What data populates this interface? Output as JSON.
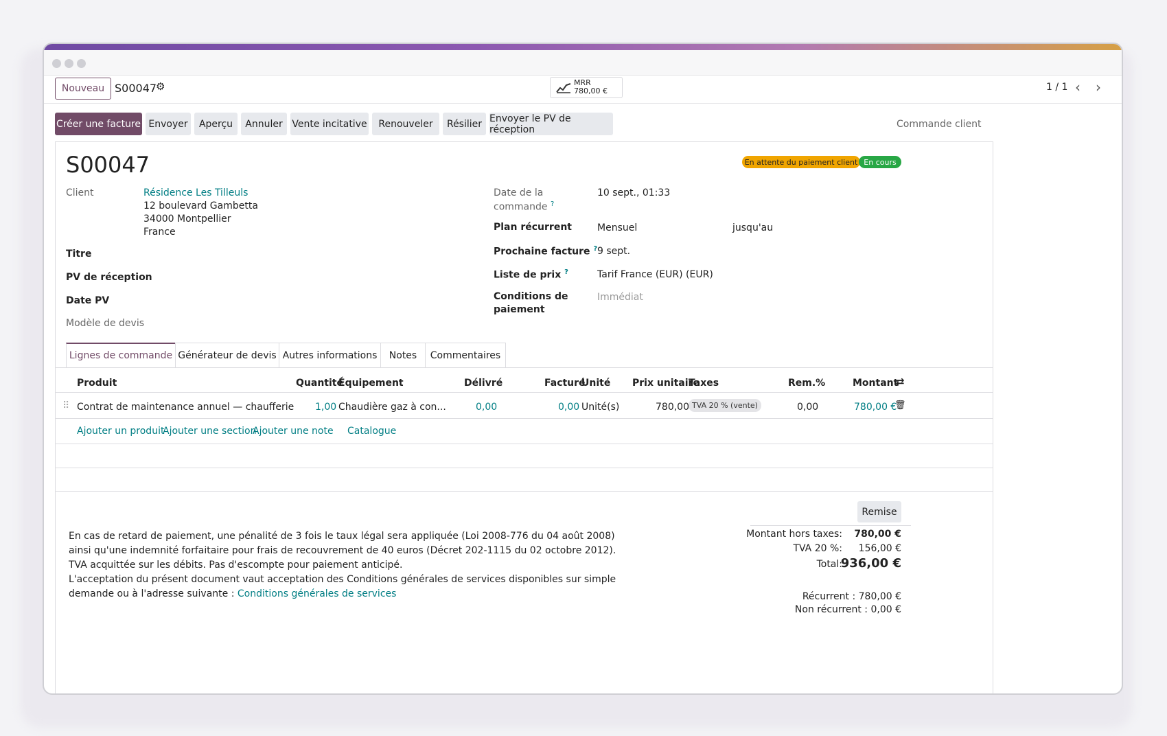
{
  "control_panel": {
    "new_button": "Nouveau",
    "record_id": "S00047",
    "mrr_label": "MRR",
    "mrr_value": "780,00 €",
    "pager": "1 / 1"
  },
  "actions": [
    "Créer une facture",
    "Envoyer",
    "Aperçu",
    "Annuler",
    "Vente incitative",
    "Renouveler",
    "Résilier",
    "Envoyer le PV de réception"
  ],
  "breadcrumb_right": "Commande client",
  "form": {
    "title": "S00047",
    "badges": {
      "pending": "En attente du paiement client",
      "in_progress": "En cours"
    },
    "client_label": "Client",
    "client_name": "Résidence Les Tilleuls",
    "client_address": [
      "12 boulevard Gambetta",
      "34000 Montpellier",
      "France"
    ],
    "titre_label": "Titre",
    "pv_label": "PV de réception",
    "date_pv_label": "Date PV",
    "template_label": "Modèle de devis",
    "order_date_label_1": "Date de la",
    "order_date_label_2": "commande",
    "order_date_value": "10 sept., 01:33",
    "plan_label": "Plan récurrent",
    "plan_value": "Mensuel",
    "until_label": "jusqu'au",
    "next_invoice_label": "Prochaine facture",
    "next_invoice_value": "9 sept.",
    "pricelist_label": "Liste de prix",
    "pricelist_value": "Tarif France (EUR) (EUR)",
    "payment_terms_label_1": "Conditions de",
    "payment_terms_label_2": "paiement",
    "payment_terms_value": "Immédiat",
    "help_mark": "?"
  },
  "tabs": [
    "Lignes de commande",
    "Générateur de devis",
    "Autres informations",
    "Notes",
    "Commentaires"
  ],
  "table": {
    "headers": {
      "product": "Produit",
      "quantity": "Quantité",
      "equipment": "Équipement",
      "delivered": "Délivré",
      "invoiced": "Facturé",
      "unit": "Unité",
      "unit_price": "Prix unitaire",
      "taxes": "Taxes",
      "discount": "Rem.%",
      "amount": "Montant"
    },
    "row": {
      "product": "Contrat de maintenance annuel — chaufferie",
      "quantity": "1,00",
      "equipment": "Chaudière gaz à con...",
      "delivered": "0,00",
      "invoiced": "0,00",
      "unit": "Unité(s)",
      "unit_price": "780,00",
      "tax": "TVA 20 % (vente)",
      "discount": "0,00",
      "amount": "780,00 €"
    },
    "add_links": {
      "product": "Ajouter un produit",
      "section": "Ajouter une section",
      "note": "Ajouter une note",
      "catalog": "Catalogue"
    }
  },
  "discount_button": "Remise",
  "terms": {
    "text": "En cas de retard de paiement, une pénalité de 3 fois le taux légal sera appliquée (Loi 2008-776 du 04 août 2008) ainsi qu'une indemnité forfaitaire pour frais de recouvrement de 40 euros (Décret 202-1115 du 02 octobre 2012). TVA acquittée sur les débits. Pas d'escompte pour paiement anticipé.",
    "text2": "L'acceptation du présent document vaut acceptation des Conditions générales de services disponibles sur simple demande ou à l'adresse suivante :",
    "link": "Conditions générales de services"
  },
  "totals": {
    "untaxed_label": "Montant hors taxes:",
    "untaxed_value": "780,00 €",
    "tax_label": "TVA 20 %:",
    "tax_value": "156,00 €",
    "total_label": "Total:",
    "total_value": "936,00 €",
    "recurring": "Récurrent : 780,00 €",
    "non_recurring": "Non récurrent : 0,00 €"
  },
  "colors": {
    "primary": "#714b67",
    "link": "#017e84",
    "badge_warning": "#f0a500",
    "badge_success": "#28a745"
  }
}
